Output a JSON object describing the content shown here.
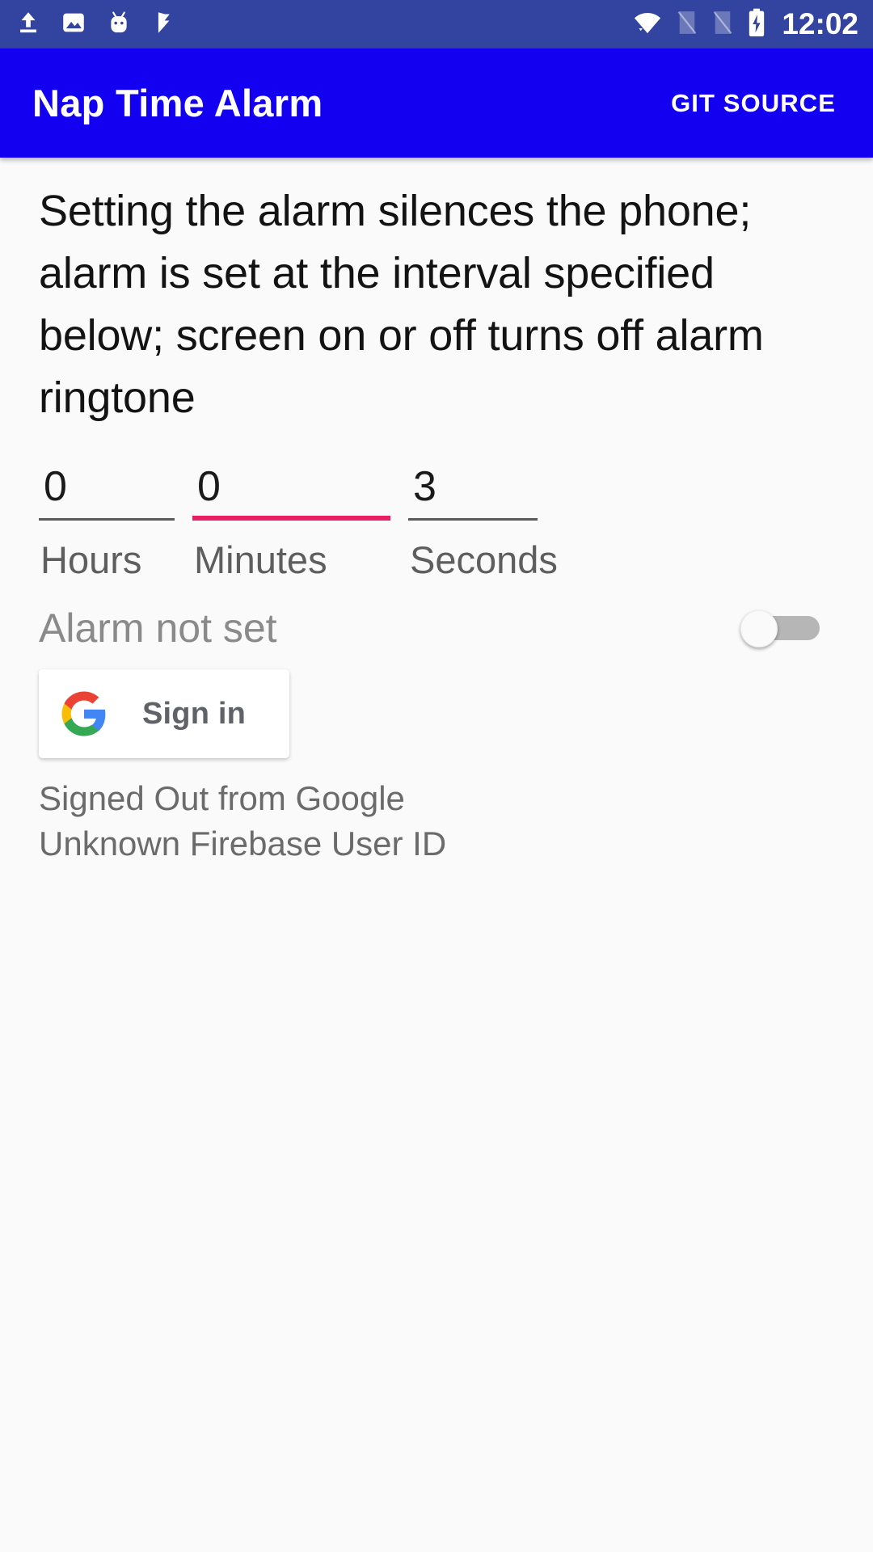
{
  "status_bar": {
    "background_color": "#3344a0",
    "time": "12:02",
    "left_icons": [
      "upload-icon",
      "image-icon",
      "android-mascot-icon",
      "checkmark-flag-icon"
    ],
    "right_icons": [
      "wifi-icon",
      "no-sim-1-icon",
      "no-sim-2-icon",
      "battery-charging-icon"
    ]
  },
  "app_bar": {
    "background_color": "#1400f0",
    "title": "Nap Time Alarm",
    "action_label": "GIT SOURCE"
  },
  "main": {
    "description": "Setting the alarm silences the phone; alarm is set at the interval specified below; screen on or off turns off alarm ringtone",
    "time_inputs": [
      {
        "value": "0",
        "label": "Hours",
        "focused": false,
        "underline_color": "#5a5a5a"
      },
      {
        "value": "0",
        "label": "Minutes",
        "focused": true,
        "underline_color": "#e91e63"
      },
      {
        "value": "3",
        "label": "Seconds",
        "focused": false,
        "underline_color": "#5a5a5a"
      }
    ],
    "alarm_status": "Alarm not set",
    "alarm_switch": {
      "state": "off",
      "track_color": "#b6b6b6",
      "thumb_color": "#fafafa"
    },
    "google_sign_in": {
      "label": "Sign in",
      "icon": "google-g-icon"
    },
    "auth_status": [
      "Signed Out from Google",
      "Unknown Firebase User ID"
    ]
  },
  "colors": {
    "accent_pink": "#e91e63",
    "app_bar_blue": "#1400f0",
    "status_bar_blue": "#3344a0",
    "page_background": "#fafafa"
  }
}
